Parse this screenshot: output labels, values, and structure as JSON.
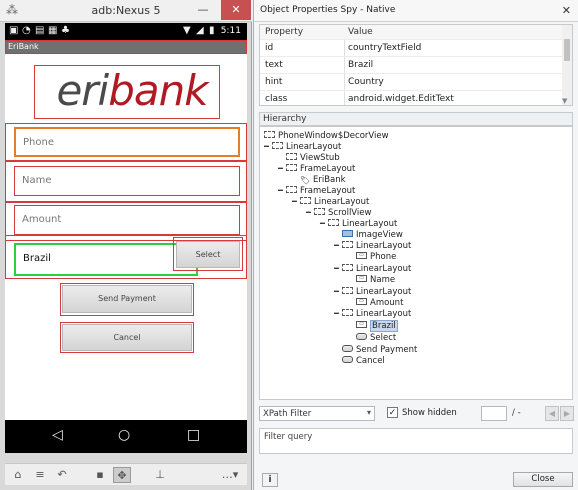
{
  "emulator": {
    "title": "adb:Nexus 5",
    "status_time": "5:11",
    "action_bar_title": "EriBank",
    "logo": {
      "part1": "eri",
      "part2": "bank",
      "color_dark": "#4a4a4a",
      "color_brand": "#b01a22"
    },
    "fields": {
      "phone": "Phone",
      "name": "Name",
      "amount": "Amount",
      "country_value": "Brazil"
    },
    "buttons": {
      "select": "Select",
      "send_payment": "Send Payment",
      "cancel": "Cancel"
    }
  },
  "spy": {
    "title": "Object Properties Spy - Native",
    "table": {
      "headers": {
        "property": "Property",
        "value": "Value"
      },
      "rows": [
        {
          "k": "id",
          "v": "countryTextField"
        },
        {
          "k": "text",
          "v": "Brazil"
        },
        {
          "k": "hint",
          "v": "Country"
        },
        {
          "k": "class",
          "v": "android.widget.EditText"
        }
      ]
    },
    "hierarchy_label": "Hierarchy",
    "tree": [
      "PhoneWindow$DecorView",
      "LinearLayout",
      "ViewStub",
      "FrameLayout",
      "EriBank",
      "FrameLayout",
      "LinearLayout",
      "ScrollView",
      "LinearLayout",
      "ImageView",
      "LinearLayout",
      "Phone",
      "LinearLayout",
      "Name",
      "LinearLayout",
      "Amount",
      "LinearLayout",
      "Brazil",
      "Select",
      "Send Payment",
      "Cancel"
    ],
    "filter": {
      "select_value": "XPath Filter",
      "show_hidden_label": "Show hidden",
      "show_hidden_checked": true,
      "page_total": "/ -"
    },
    "query_placeholder": "Filter query",
    "info_label": "i",
    "close_label": "Close"
  }
}
